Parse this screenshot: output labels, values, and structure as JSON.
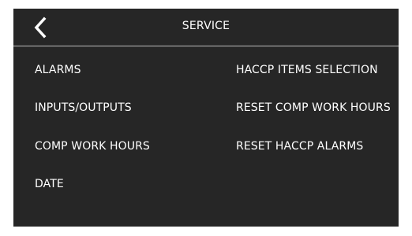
{
  "header": {
    "title": "SERVICE",
    "back_icon": "chevron-left-icon"
  },
  "menu": {
    "left": [
      {
        "label": "ALARMS"
      },
      {
        "label": "INPUTS/OUTPUTS"
      },
      {
        "label": "COMP WORK HOURS"
      },
      {
        "label": "DATE"
      }
    ],
    "right": [
      {
        "label": "HACCP ITEMS SELECTION"
      },
      {
        "label": "RESET COMP WORK HOURS"
      },
      {
        "label": "RESET HACCP ALARMS"
      }
    ]
  },
  "colors": {
    "background": "#262626",
    "text": "#ffffff",
    "divider": "#bdbdbd"
  }
}
